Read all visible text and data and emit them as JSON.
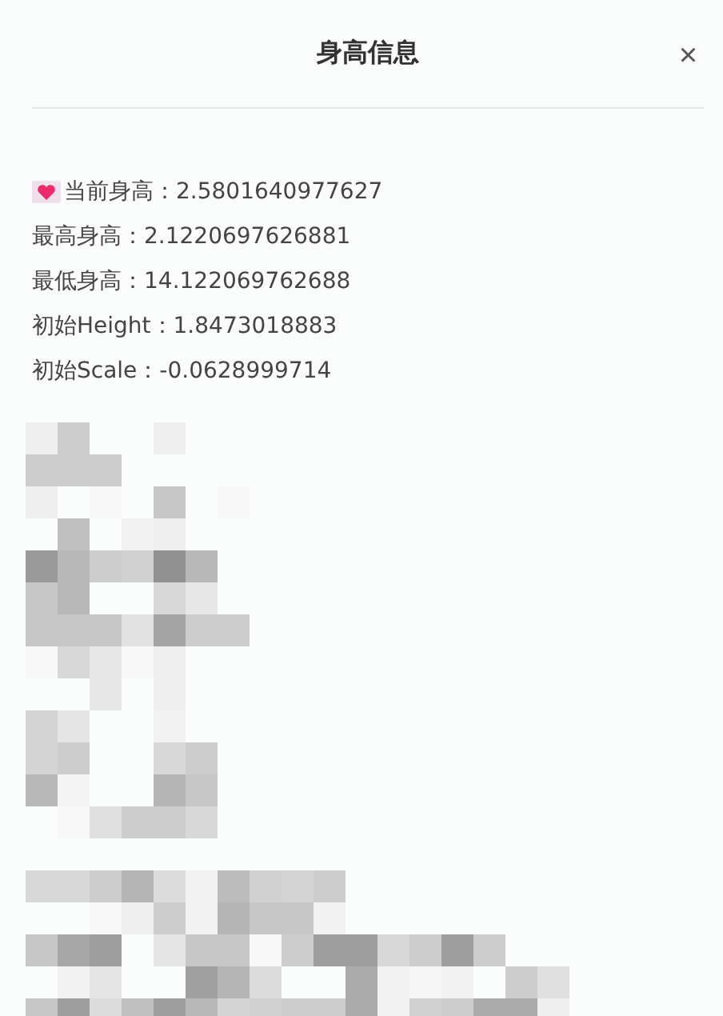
{
  "dialog": {
    "title": "身高信息",
    "close": "×"
  },
  "lines": [
    {
      "kind": "heart",
      "text": "当前身高：2.5801640977627"
    },
    {
      "kind": "plain",
      "text": "最高身高：2.1220697626881"
    },
    {
      "kind": "plain",
      "text": "最低身高：14.122069762688"
    },
    {
      "kind": "plain",
      "text": "初始Height：1.8473018883"
    },
    {
      "kind": "plain",
      "text": "初始Scale：-0.0628999714"
    }
  ]
}
